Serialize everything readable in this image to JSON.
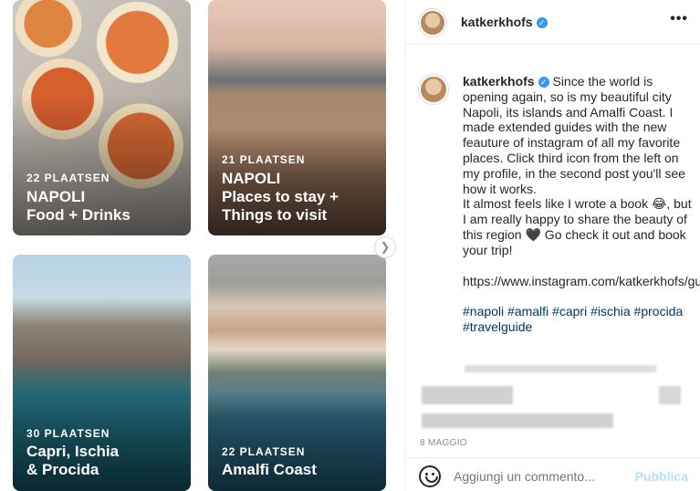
{
  "guides": [
    {
      "count": "22 PLAATSEN",
      "title_line1": "NAPOLI",
      "title_line2": "Food + Drinks"
    },
    {
      "count": "21 PLAATSEN",
      "title_line1": "NAPOLI",
      "title_line2": "Places to stay +",
      "title_line3": "Things to visit"
    },
    {
      "count": "30 PLAATSEN",
      "title_line1": "Capri, Ischia",
      "title_line2": "& Procida"
    },
    {
      "count": "22 PLAATSEN",
      "title_line1": "Amalfi Coast"
    }
  ],
  "header": {
    "username": "katkerkhofs",
    "verified_icon": "verified-badge-icon",
    "more_label": "•••"
  },
  "caption": {
    "username": "katkerkhofs",
    "text1": "Since the world is opening again, so is my beautiful city Napoli, its islands and Amalfi Coast. I made extended guides with the new feauture of instagram of all my favorite places. Click third icon from the left on my profile, in the second post you'll see how it works.",
    "text2": "It almost feels like I wrote a book 😂, but I am really happy to share the beauty of this region 🖤 Go check it out and book your trip!",
    "link": "https://www.instagram.com/katkerkhofs/guides/",
    "hashtags": "#napoli #amalfi #capri #ischia #procida #travelguide"
  },
  "date": "8 MAGGIO",
  "comment": {
    "placeholder": "Aggiungi un commento...",
    "post_label": "Pubblica"
  },
  "colors": {
    "link_blue": "#3897f0",
    "hashtag": "#00376b",
    "post_disabled": "#b2dffc"
  }
}
